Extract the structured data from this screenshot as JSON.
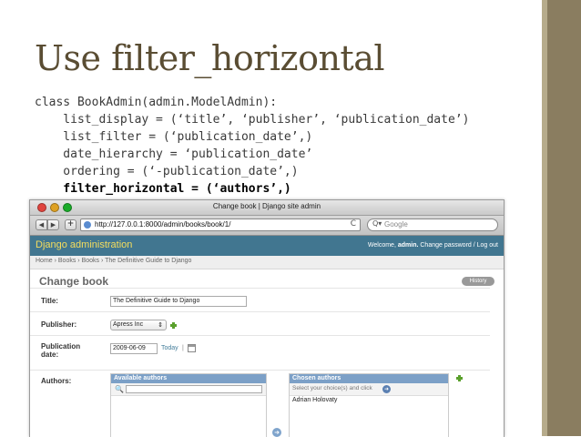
{
  "slide": {
    "title": "Use filter_horizontal",
    "code_lines": [
      "class BookAdmin(admin.ModelAdmin):",
      "    list_display = (‘title’, ‘publisher’, ‘publication_date’)",
      "    list_filter = (‘publication_date’,)",
      "    date_hierarchy = ‘publication_date’",
      "    ordering = (‘-publication_date’,)"
    ],
    "code_bold_line": "    filter_horizontal = (‘authors’,)"
  },
  "browser": {
    "window_title": "Change book | Django site admin",
    "back_icon": "◀",
    "forward_icon": "▶",
    "add_icon": "+",
    "url": "http://127.0.0.1:8000/admin/books/book/1/",
    "reload_icon": "C",
    "search_icon": "Q▾",
    "search_placeholder": "Google"
  },
  "admin": {
    "brand": "Django administration",
    "welcome_prefix": "Welcome,",
    "username": "admin.",
    "user_links": "Change password / Log out",
    "breadcrumbs": "Home › Books › Books › The Definitive Guide to Django",
    "page_heading": "Change book",
    "history_button": "History",
    "fields": {
      "title_label": "Title:",
      "title_value": "The Definitive Guide to Django",
      "publisher_label": "Publisher:",
      "publisher_value": "Apress Inc",
      "publisher_arrows": "⇕",
      "pubdate_label_1": "Publication",
      "pubdate_label_2": "date:",
      "pubdate_value": "2009-06-09",
      "today_link": "Today",
      "today_sep": "|",
      "authors_label": "Authors:"
    },
    "selector": {
      "available_title": "Available authors",
      "search_icon": "🔍",
      "chosen_title": "Chosen authors",
      "chosen_help": "Select your choice(s) and click",
      "arrow_icon": "➜",
      "chosen_items": [
        "Adrian Holovaty"
      ]
    }
  }
}
